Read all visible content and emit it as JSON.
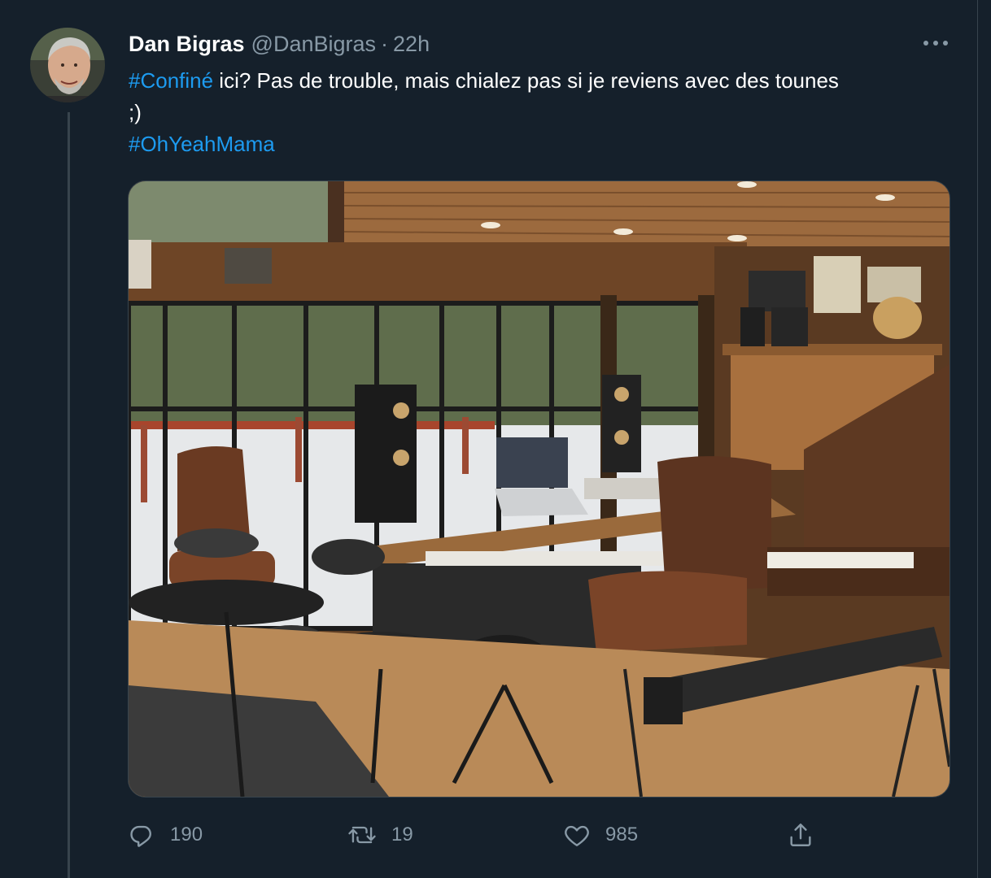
{
  "tweet": {
    "author_name": "Dan Bigras",
    "handle": "@DanBigras",
    "separator": "·",
    "time": "22h",
    "text_line1_tag": "#Confiné",
    "text_line1_rest": " ici? Pas de trouble, mais chialez pas si je reviens avec des tounes",
    "text_line2": ";)",
    "text_line3_tag": "#OhYeahMama"
  },
  "actions": {
    "replies": "190",
    "retweets": "19",
    "likes": "985"
  },
  "icons": {
    "more": "more-dots-icon",
    "reply": "reply-bubble-icon",
    "retweet": "retweet-icon",
    "like": "heart-icon",
    "share": "share-upload-icon"
  },
  "colors": {
    "background": "#15202b",
    "link": "#1d9bf0",
    "secondary_text": "#8899a6",
    "border": "#38444d"
  }
}
